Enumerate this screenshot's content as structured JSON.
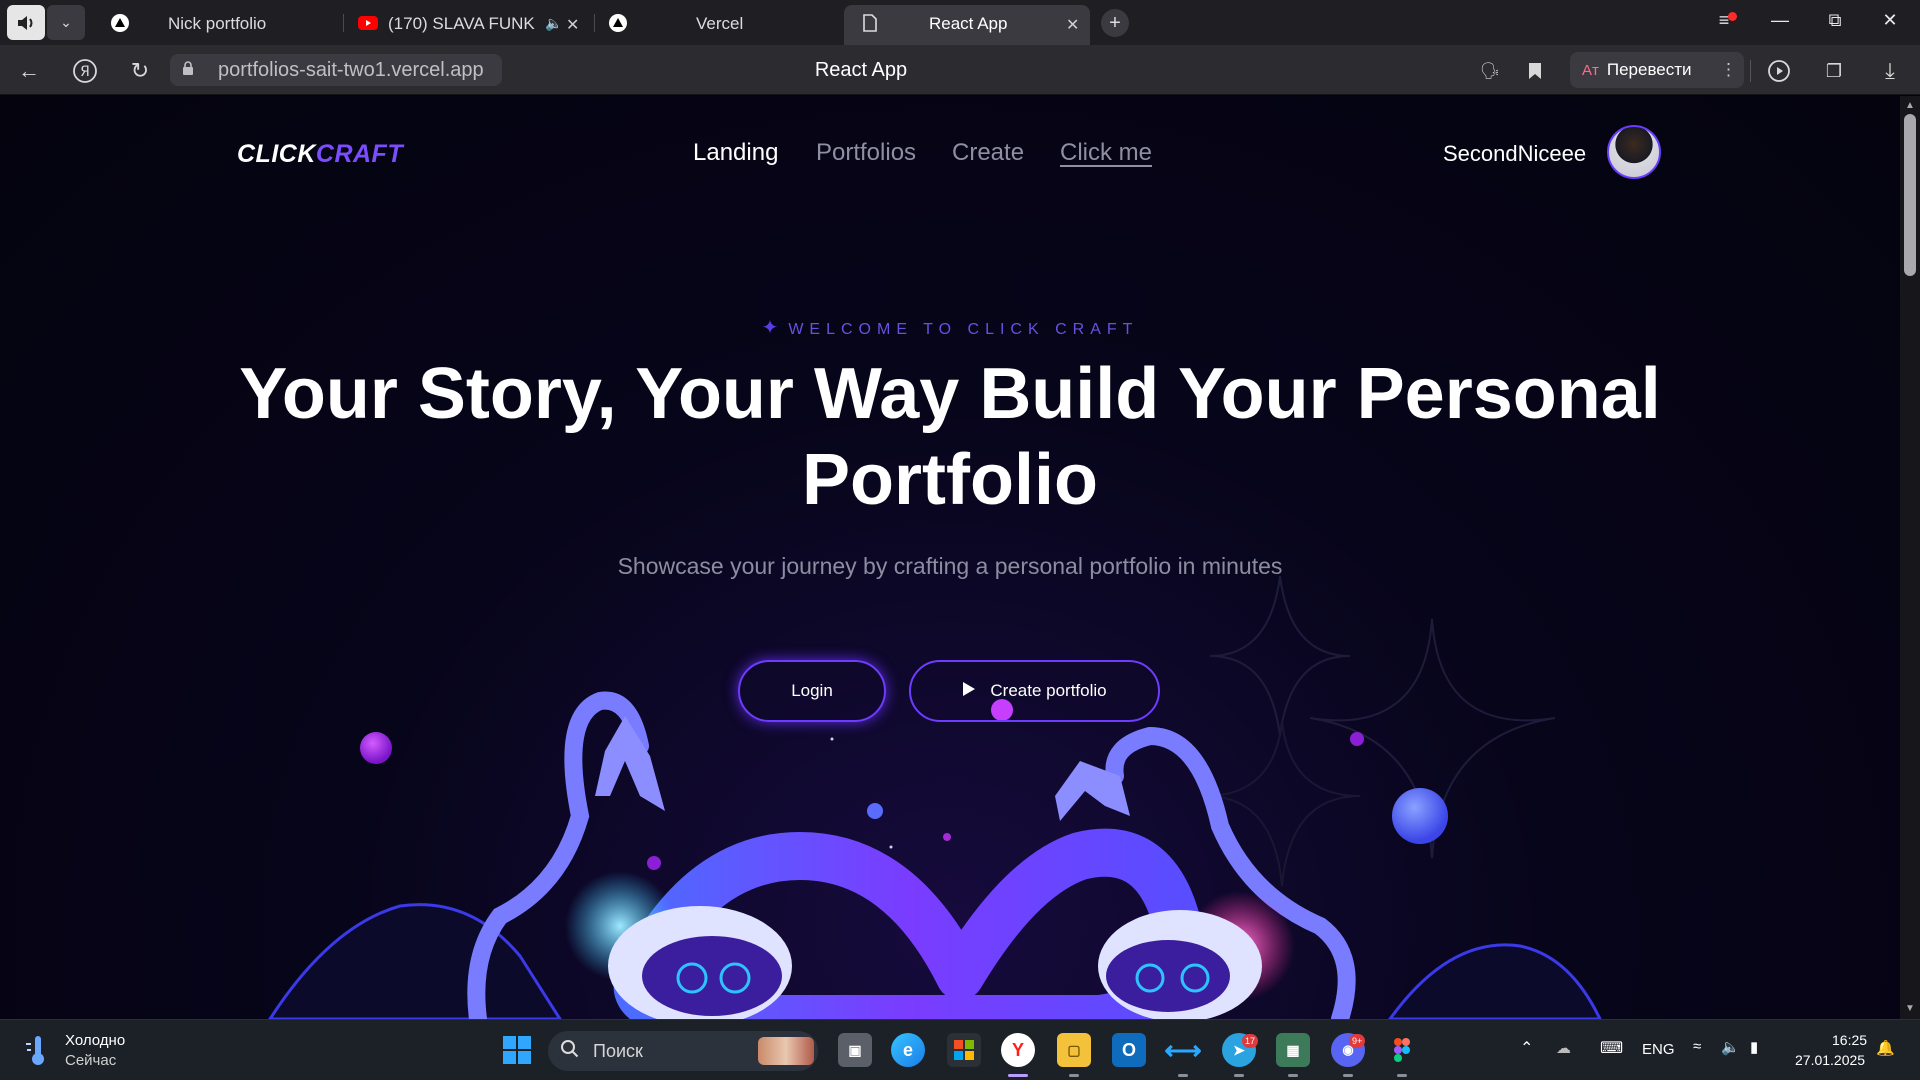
{
  "browser": {
    "tabs": [
      {
        "title": "Nick portfolio",
        "icon": "vercel-triangle-icon"
      },
      {
        "title": "(170) SLAVA FUNK!",
        "icon": "youtube-icon"
      },
      {
        "title": "Vercel",
        "icon": "vercel-triangle-icon"
      },
      {
        "title": "React App",
        "icon": "document-icon"
      }
    ],
    "url": "portfolios-sait-two1.vercel.app",
    "page_title": "React App",
    "translate_label": "Перевести"
  },
  "site": {
    "logo_part1": "CLICK",
    "logo_part2": "CRAFT",
    "nav": [
      "Landing",
      "Portfolios",
      "Create",
      "Click me"
    ],
    "username": "SecondNiceee",
    "welcome": "WELCOME TO CLICK CRAFT",
    "hero_title": "Your Story, Your Way Build Your Personal Portfolio",
    "subtitle": "Showcase your journey by crafting a personal portfolio in minutes",
    "login_label": "Login",
    "create_label": "Create portfolio",
    "accent_color": "#6e3cff"
  },
  "taskbar": {
    "weather_title": "Холодно",
    "weather_sub": "Сейчас",
    "search_placeholder": "Поиск",
    "lang": "ENG",
    "time": "16:25",
    "date": "27.01.2025",
    "telegram_badge": "17",
    "discord_badge": "9+"
  }
}
